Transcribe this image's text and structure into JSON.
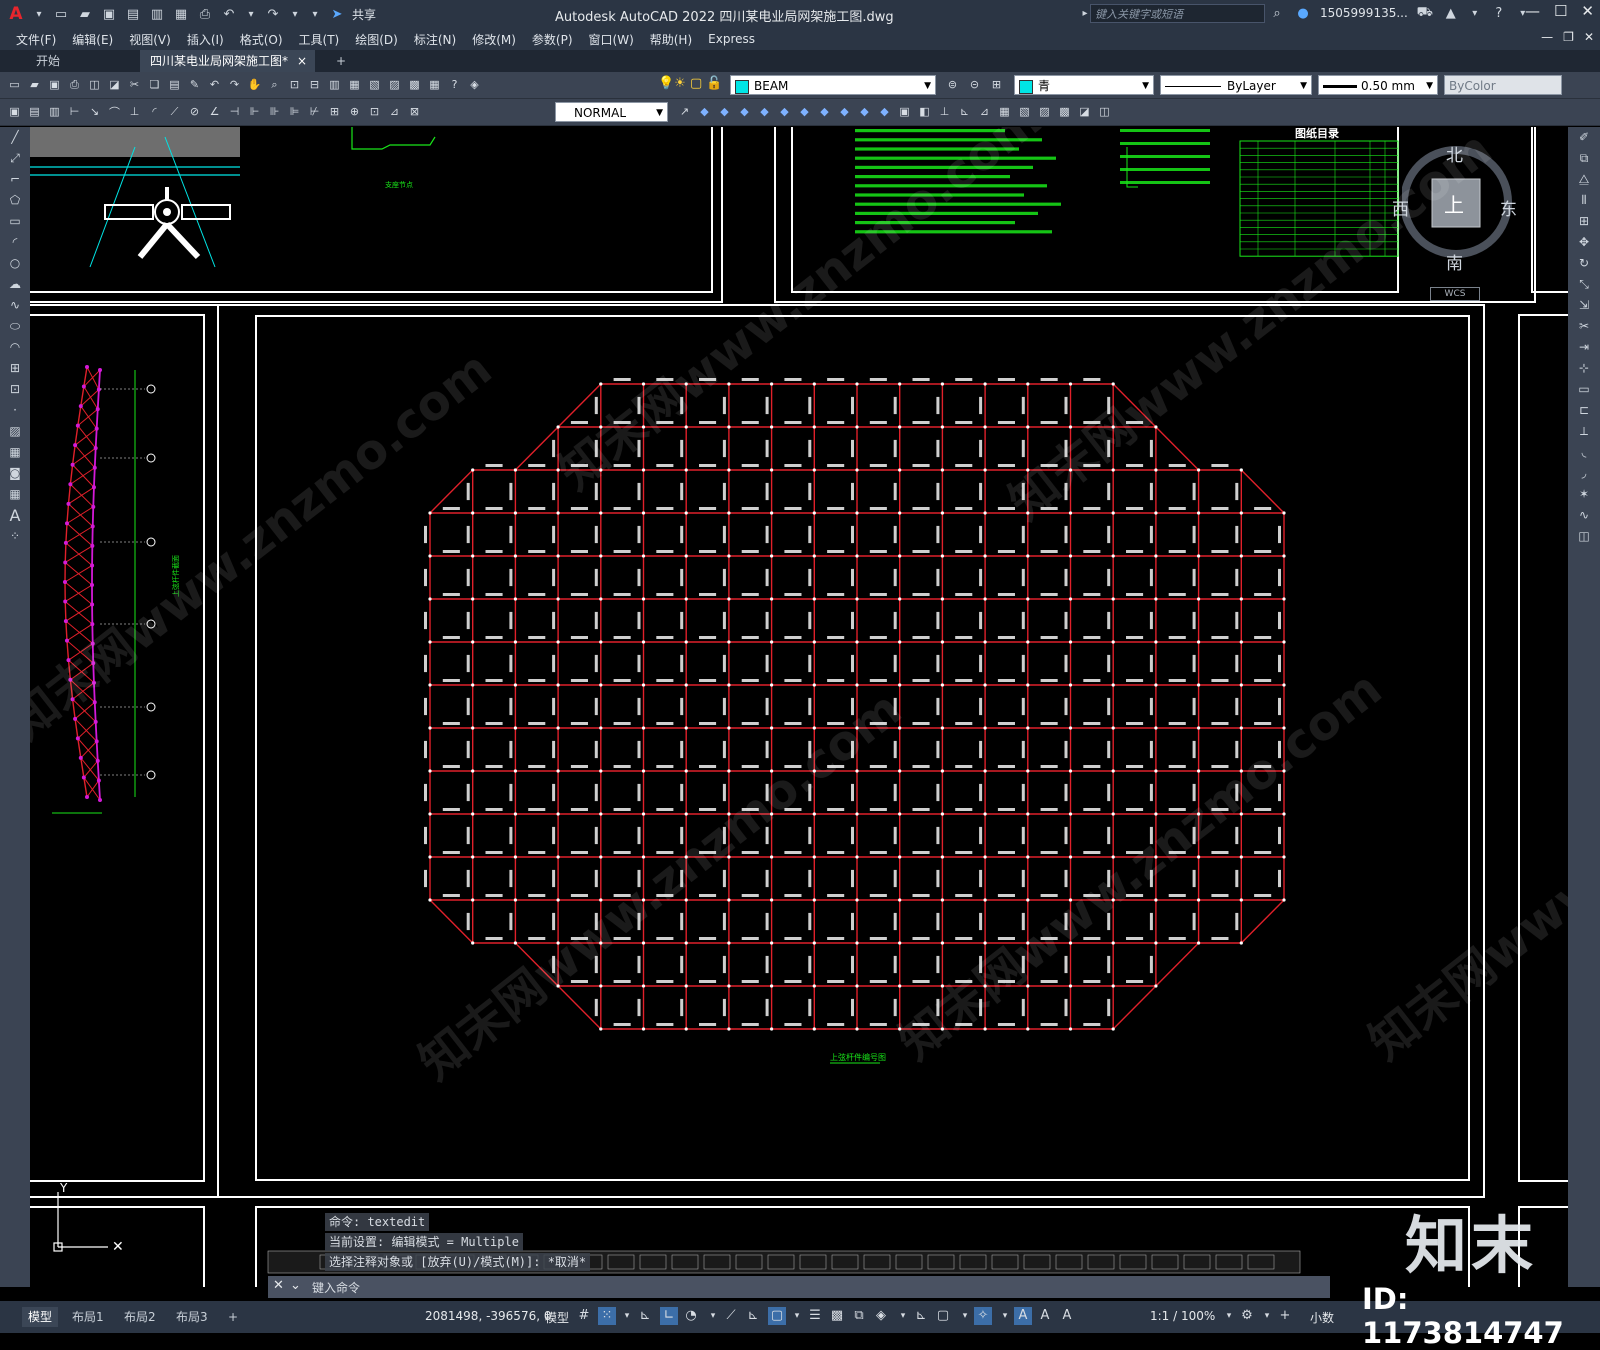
{
  "app": {
    "title": "Autodesk AutoCAD 2022    四川某电业局网架施工图.dwg",
    "share_label": "共享",
    "search_placeholder": "键入关键字或短语",
    "user": "1505999135..."
  },
  "menu": [
    "文件(F)",
    "编辑(E)",
    "视图(V)",
    "插入(I)",
    "格式(O)",
    "工具(T)",
    "绘图(D)",
    "标注(N)",
    "修改(M)",
    "参数(P)",
    "窗口(W)",
    "帮助(H)",
    "Express"
  ],
  "tabs": {
    "start": "开始",
    "drawing": "四川某电业局网架施工图*",
    "close": "×",
    "add": "+"
  },
  "toolbar": {
    "layer": "BEAM",
    "color": "青",
    "linetype": "ByLayer",
    "lineweight": "0.50 mm",
    "plotstyle": "ByColor",
    "textstyle": "NORMAL",
    "layer_color": "#00e5e5",
    "color_swatch": "#00e5e5"
  },
  "viewcube": {
    "north": "北",
    "south": "南",
    "east": "东",
    "west": "西",
    "top": "上",
    "wcs": "WCS"
  },
  "drawing": {
    "notes_title": "图纸目录",
    "plan_caption": "上弦杆件编号图",
    "elevation_caption": "上弦杆件截面",
    "accent_red": "#e0202a",
    "accent_green": "#19e619",
    "accent_magenta": "#d41ad8"
  },
  "command": {
    "history": [
      "命令:  textedit",
      "当前设置: 编辑模式 = Multiple",
      "选择注释对象或 [放弃(U)/模式(M)]: *取消*"
    ],
    "prompt": "键入命令"
  },
  "status": {
    "layouts": [
      "模型",
      "布局1",
      "布局2",
      "布局3"
    ],
    "add_layout": "+",
    "coords": "2081498, -396576, 0",
    "model": "模型",
    "scale": "1:1 / 100%",
    "units": "小数"
  },
  "watermark": {
    "logo": "知末",
    "id": "ID: 1173814747",
    "site": "知末网www.znzmo.com"
  }
}
